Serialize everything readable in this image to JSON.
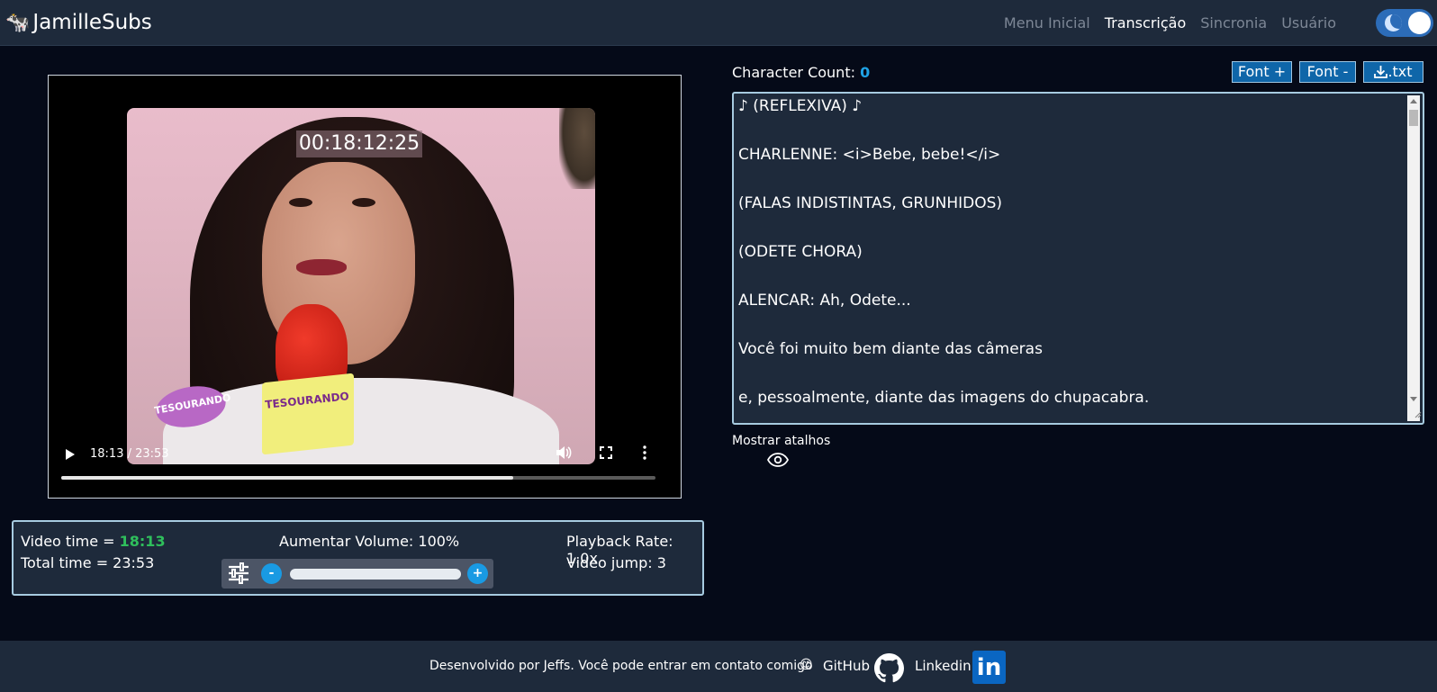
{
  "navbar": {
    "brand_icon": "🐄",
    "brand": "JamilleSubs",
    "links": [
      {
        "label": "Menu Inicial",
        "active": false
      },
      {
        "label": "Transcrição",
        "active": true
      },
      {
        "label": "Sincronia",
        "active": false
      },
      {
        "label": "Usuário",
        "active": false
      }
    ],
    "theme_toggle": "dark-mode-on"
  },
  "video": {
    "timecode_overlay": "00:18:12:25",
    "time_display": "18:13 / 23:53",
    "progress_fraction": 0.76,
    "overlay_texts": {
      "logo": "TESOURANDO",
      "mic_flag": "TESOURANDO"
    }
  },
  "info_panel": {
    "video_time_label": "Video time = ",
    "video_time_value": "18:13",
    "total_time": "Total time = 23:53",
    "volume_label": "Aumentar Volume: 100%",
    "volume_minus": "-",
    "volume_plus": "+",
    "playback_rate": "Playback Rate: 1.0x",
    "video_jump": "Video jump: 3"
  },
  "editor": {
    "char_count_label": "Character Count: ",
    "char_count_value": "0",
    "buttons": {
      "font_plus": "Font +",
      "font_minus": "Font -",
      "download": ".txt"
    },
    "lines": [
      "♪ (REFLEXIVA) ♪",
      "CHARLENNE: <i>Bebe, bebe!</i>",
      "(FALAS INDISTINTAS, GRUNHIDOS)",
      "(ODETE CHORA)",
      "ALENCAR: Ah, Odete...",
      "Você foi muito bem diante das câmeras",
      "e, pessoalmente, diante das imagens do chupacabra."
    ],
    "shortcuts_label": "Mostrar atalhos"
  },
  "footer": {
    "text": "Desenvolvido por Jeffs. Você pode entrar em contato comigo",
    "emoji": "😊",
    "github": "GitHub",
    "linkedin": "Linkedin",
    "linkedin_logo": "in"
  },
  "colors": {
    "page_bg": "#050a18",
    "panel_bg": "#1e2a3b",
    "accent_blue": "#199ae3",
    "button_blue": "#0f66a9",
    "green": "#2fbf5c",
    "panel_border": "#a7cbe0"
  }
}
